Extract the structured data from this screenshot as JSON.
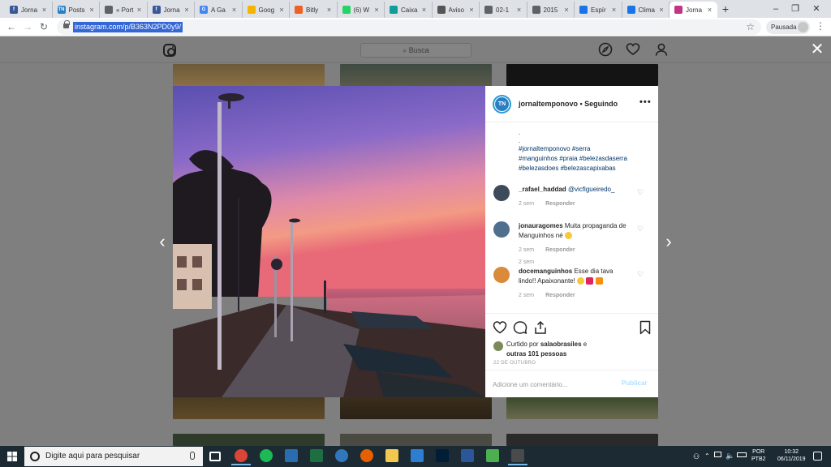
{
  "browser": {
    "tabs": [
      {
        "label": "Jorna",
        "color": "#3b5998",
        "glyph": "f"
      },
      {
        "label": "Posts",
        "color": "#2a7fc2",
        "glyph": "TN"
      },
      {
        "label": "« Port",
        "color": "#5f6368",
        "glyph": ""
      },
      {
        "label": "Jorna",
        "color": "#3b5998",
        "glyph": "f"
      },
      {
        "label": "A Ga",
        "color": "#4285f4",
        "glyph": "G"
      },
      {
        "label": "Goog",
        "color": "#f4b400",
        "glyph": ""
      },
      {
        "label": "Bitly",
        "color": "#ee6123",
        "glyph": ""
      },
      {
        "label": "(6) W",
        "color": "#25d366",
        "glyph": ""
      },
      {
        "label": "Caixa",
        "color": "#0f9d9a",
        "glyph": ""
      },
      {
        "label": "Aviso",
        "color": "#555555",
        "glyph": ""
      },
      {
        "label": "02-1",
        "color": "#5f6368",
        "glyph": ""
      },
      {
        "label": "2015",
        "color": "#5f6368",
        "glyph": ""
      },
      {
        "label": "Espír",
        "color": "#1a73e8",
        "glyph": ""
      },
      {
        "label": "Clima",
        "color": "#1a73e8",
        "glyph": ""
      },
      {
        "label": "Jorna",
        "color": "#c13584",
        "glyph": ""
      }
    ],
    "active_tab_index": 14,
    "new_tab_glyph": "+",
    "window_controls": [
      "‒",
      "❐",
      "✕"
    ],
    "url": "instagram.com/p/B363N2PD0y9/",
    "profile_label": "Pausada",
    "menu_glyph": "⋮"
  },
  "instagram": {
    "search_placeholder": "Busca",
    "post": {
      "author": "jornaltemponovo",
      "separator": " • ",
      "follow_state": "Seguindo",
      "avatar_text": "TN",
      "caption_dots": [
        ".",
        "."
      ],
      "hashtags": [
        "#jornaltemponovo",
        "#serra",
        "#manguinhos",
        "#praia",
        "#belezasdaserra",
        "#belezasdoes",
        "#belezascapixabas"
      ],
      "caption_time": "2 sem",
      "comments": [
        {
          "user": "_rafael_haddad",
          "text": "",
          "mention": "@vicfigueiredo_",
          "time": "2 sem",
          "reply": "Responder",
          "avatar_color": "#3d4a5a"
        },
        {
          "user": "jonauragomes",
          "text": "Muita propaganda de Manguinhos né",
          "mention": "",
          "time": "2 sem",
          "reply": "Responder",
          "avatar_color": "#4f6f8f"
        },
        {
          "user": "docemanguinhos",
          "text": "Esse dia tava lindo!! Apaixonante!",
          "mention": "",
          "time": "2 sem",
          "reply": "Responder",
          "avatar_color": "#d98a3a"
        }
      ],
      "liked_by_prefix": "Curtido por",
      "liked_by_user": "salaobrasiles",
      "liked_by_joiner": "e",
      "liked_by_others": "outras 101 pessoas",
      "date": "22 DE OUTUBRO",
      "comment_placeholder": "Adicione um comentário...",
      "publish_label": "Publicar"
    }
  },
  "taskbar": {
    "search_placeholder": "Digite aqui para pesquisar",
    "apps": [
      {
        "name": "task-view",
        "color": "#ffffff",
        "running": false
      },
      {
        "name": "chrome",
        "color": "#db4437",
        "running": true
      },
      {
        "name": "spotify",
        "color": "#1db954",
        "running": false
      },
      {
        "name": "visual-app",
        "color": "#2b6cb0",
        "running": false
      },
      {
        "name": "excel",
        "color": "#1d6f42",
        "running": false
      },
      {
        "name": "edge",
        "color": "#3277bc",
        "running": false
      },
      {
        "name": "firefox",
        "color": "#e66000",
        "running": false
      },
      {
        "name": "file-explorer",
        "color": "#f2c94c",
        "running": false
      },
      {
        "name": "store",
        "color": "#2d7dd2",
        "running": false
      },
      {
        "name": "photoshop",
        "color": "#001e36",
        "running": false
      },
      {
        "name": "word",
        "color": "#2b579a",
        "running": false
      },
      {
        "name": "app-green",
        "color": "#4caf50",
        "running": false
      },
      {
        "name": "photos",
        "color": "#4a4a4a",
        "running": true
      }
    ],
    "lang_line1": "POR",
    "lang_line2": "PTB2",
    "time": "10:32",
    "date": "06/11/2019"
  }
}
